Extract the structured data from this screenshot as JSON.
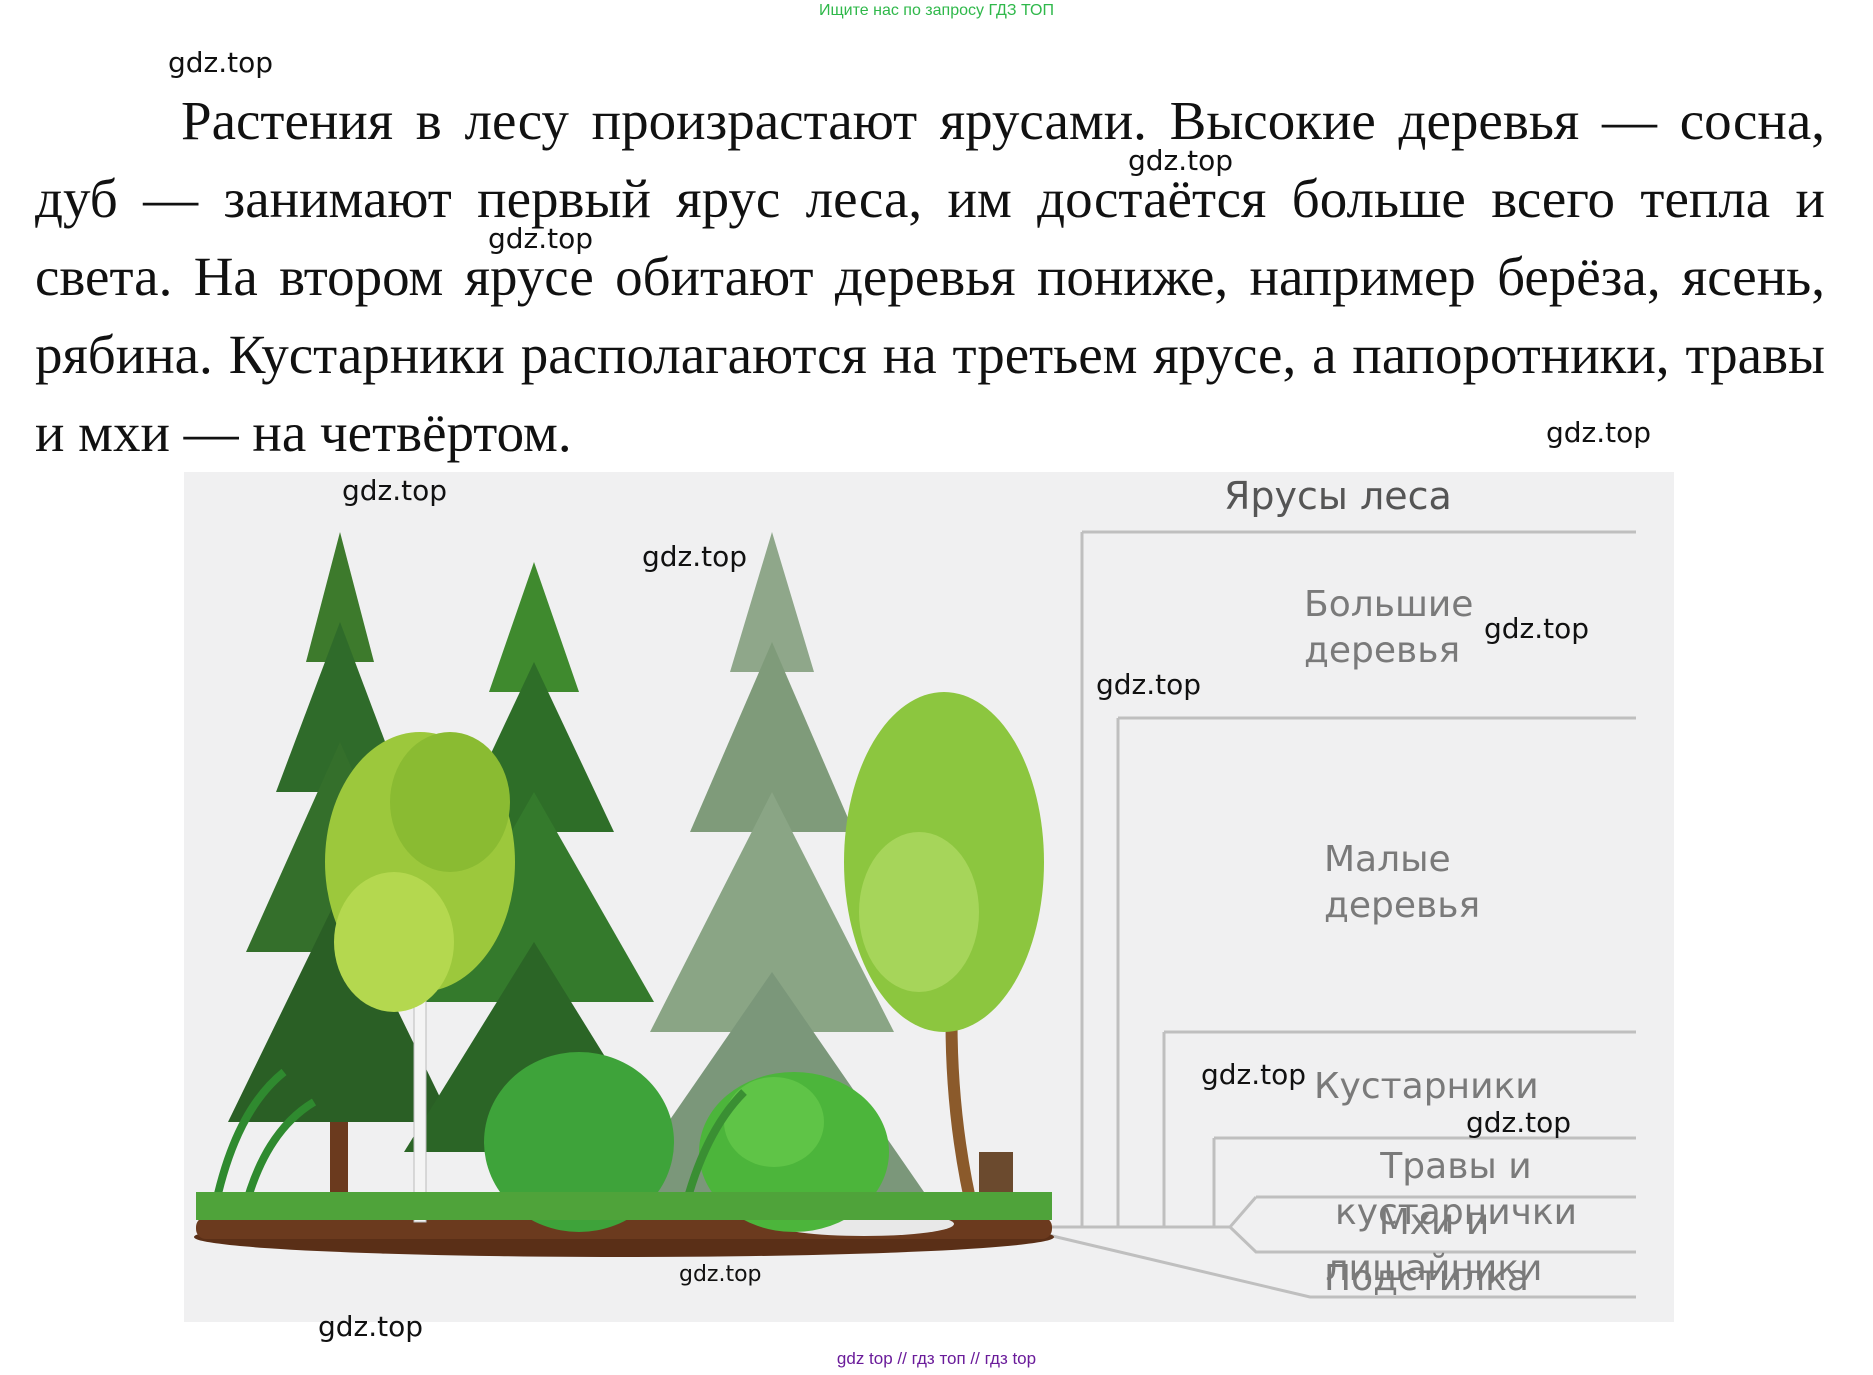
{
  "header": {
    "link_text": "Ищите нас по запросу ГДЗ ТОП"
  },
  "watermark": "gdz.top",
  "paragraph": "Растения в лесу произрастают ярусами. Высокие деревья — сосна, дуб — занимают первый ярус леса, им достаётся больше всего тепла и света. На втором ярусе обитают деревья пониже, например берёза, ясень, рябина. Кустарники располагаются на третьем ярусе, а папоротники, травы и мхи — на четвёртом.",
  "figure": {
    "title": "Ярусы леса",
    "tiers": {
      "big_trees": "Большие деревья",
      "small_trees": "Малые деревья",
      "shrubs": "Кустарники",
      "grasses": "Травы и кустарнички",
      "mosses": "Мхи и лишайники",
      "litter": "Подстилка"
    }
  },
  "footer": {
    "text": "gdz top // гдз топ // гдз top"
  },
  "colors": {
    "header_link": "#2fb84a",
    "footer_link": "#6a1b9a",
    "figure_background": "#f0f0f1",
    "tier_text": "#7a7a7a",
    "dark_conifer": "#2f6b2a",
    "birch_leaves": "#9cc83c",
    "soil": "#6b3a1e",
    "grass": "#4fa33a"
  }
}
